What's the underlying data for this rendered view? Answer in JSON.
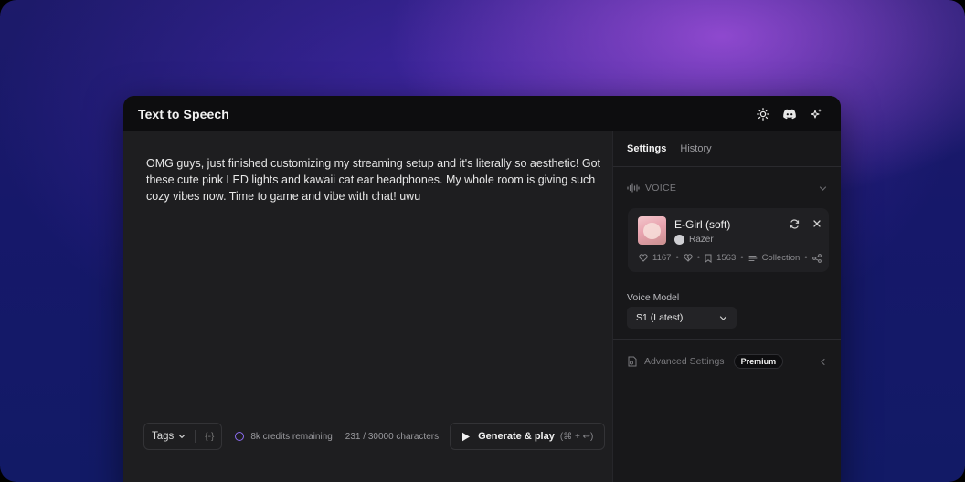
{
  "window": {
    "title": "Text to Speech"
  },
  "toolbar_icons": [
    "sun-icon",
    "discord-icon",
    "sparkle-icon"
  ],
  "editor": {
    "text": "OMG guys, just finished customizing my streaming setup and it's literally so aesthetic! Got these cute pink LED lights and kawaii cat ear headphones. My whole room is giving such cozy vibes now. Time to game and vibe with chat! uwu"
  },
  "bottom_bar": {
    "tags_label": "Tags",
    "braces_label": "{-}",
    "credits": "8k credits remaining",
    "characters": "231 / 30000 characters",
    "generate_label": "Generate & play",
    "generate_shortcut": "(⌘ + ↩)"
  },
  "sidebar": {
    "tabs": [
      {
        "label": "Settings",
        "active": true
      },
      {
        "label": "History",
        "active": false
      }
    ],
    "voice_section": "VOICE",
    "voice": {
      "name": "E-Girl (soft)",
      "author": "Razer",
      "likes": "1167",
      "saves": "1563",
      "collection_label": "Collection"
    },
    "voice_model_label": "Voice Model",
    "voice_model_value": "S1 (Latest)",
    "advanced_label": "Advanced Settings",
    "premium_badge": "Premium"
  },
  "colors": {
    "accent": "#8b6cf0",
    "window_bg": "#1c1c1e",
    "titlebar_bg": "#0d0d0f"
  }
}
